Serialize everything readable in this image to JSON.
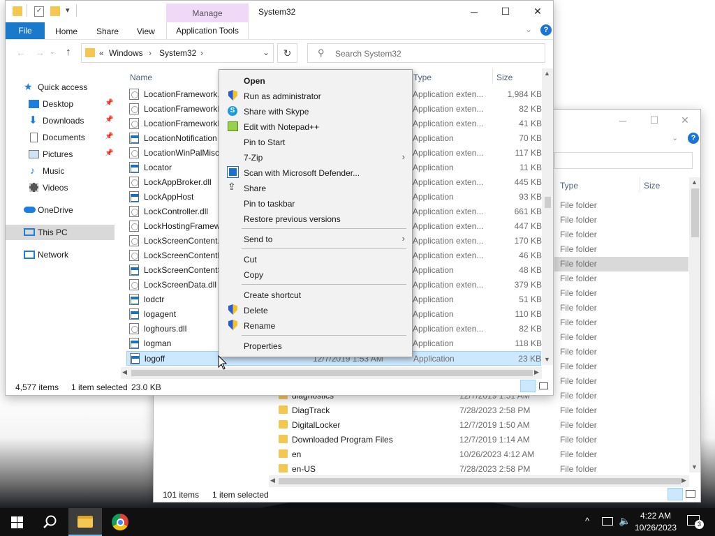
{
  "window_main": {
    "title": "System32",
    "context_tab_group": "Manage",
    "ribbon_tabs": [
      "File",
      "Home",
      "Share",
      "View",
      "Application Tools"
    ],
    "breadcrumb": {
      "overflow": "«",
      "parts": [
        "Windows",
        "System32"
      ]
    },
    "search_placeholder": "Search System32",
    "columns": {
      "name": "Name",
      "type": "Type",
      "size": "Size"
    },
    "nav": {
      "quick_access": "Quick access",
      "desktop": "Desktop",
      "downloads": "Downloads",
      "documents": "Documents",
      "pictures": "Pictures",
      "music": "Music",
      "videos": "Videos",
      "onedrive": "OneDrive",
      "this_pc": "This PC",
      "network": "Network"
    },
    "files": [
      {
        "name": "LocationFramework.",
        "type": "Application exten...",
        "size": "1,984 KB",
        "icon": "dll"
      },
      {
        "name": "LocationFrameworkI",
        "type": "Application exten...",
        "size": "82 KB",
        "icon": "dll"
      },
      {
        "name": "LocationFrameworkI",
        "type": "Application exten...",
        "size": "41 KB",
        "icon": "dll"
      },
      {
        "name": "LocationNotification",
        "type": "Application",
        "size": "70 KB",
        "icon": "app"
      },
      {
        "name": "LocationWinPalMisc",
        "type": "Application exten...",
        "size": "117 KB",
        "icon": "dll"
      },
      {
        "name": "Locator",
        "type": "Application",
        "size": "11 KB",
        "icon": "app"
      },
      {
        "name": "LockAppBroker.dll",
        "type": "Application exten...",
        "size": "445 KB",
        "icon": "dll"
      },
      {
        "name": "LockAppHost",
        "type": "Application",
        "size": "93 KB",
        "icon": "app"
      },
      {
        "name": "LockController.dll",
        "type": "Application exten...",
        "size": "661 KB",
        "icon": "dll"
      },
      {
        "name": "LockHostingFramew",
        "type": "Application exten...",
        "size": "447 KB",
        "icon": "dll"
      },
      {
        "name": "LockScreenContent.",
        "type": "Application exten...",
        "size": "170 KB",
        "icon": "dll"
      },
      {
        "name": "LockScreenContentH",
        "type": "Application exten...",
        "size": "46 KB",
        "icon": "dll"
      },
      {
        "name": "LockScreenContentS",
        "type": "Application",
        "size": "48 KB",
        "icon": "app"
      },
      {
        "name": "LockScreenData.dll",
        "type": "Application exten...",
        "size": "379 KB",
        "icon": "dll"
      },
      {
        "name": "lodctr",
        "type": "Application",
        "size": "51 KB",
        "icon": "app"
      },
      {
        "name": "logagent",
        "type": "Application",
        "size": "110 KB",
        "icon": "app"
      },
      {
        "name": "loghours.dll",
        "type": "Application exten...",
        "size": "82 KB",
        "icon": "dll"
      },
      {
        "name": "logman",
        "type": "Application",
        "size": "118 KB",
        "icon": "app"
      },
      {
        "name": "logoff",
        "date": "12/7/2019 1:53 AM",
        "type": "Application",
        "size": "23 KB",
        "icon": "app",
        "selected": true
      }
    ],
    "status": {
      "count": "4,577 items",
      "selected": "1 item selected",
      "size": "23.0 KB"
    }
  },
  "context_menu": [
    {
      "label": "Open",
      "bold": true
    },
    {
      "label": "Run as administrator",
      "icon": "shield-icon"
    },
    {
      "label": "Share with Skype",
      "icon": "skype-icon"
    },
    {
      "label": "Edit with Notepad++",
      "icon": "notepadpp-icon"
    },
    {
      "label": "Pin to Start"
    },
    {
      "label": "7-Zip",
      "submenu": true
    },
    {
      "label": "Scan with Microsoft Defender...",
      "icon": "defender-icon"
    },
    {
      "label": "Share",
      "icon": "share-icon"
    },
    {
      "label": "Pin to taskbar"
    },
    {
      "label": "Restore previous versions"
    },
    {
      "sep": true
    },
    {
      "label": "Send to",
      "submenu": true
    },
    {
      "sep": true
    },
    {
      "label": "Cut"
    },
    {
      "label": "Copy"
    },
    {
      "sep": true
    },
    {
      "label": "Create shortcut"
    },
    {
      "label": "Delete",
      "icon": "shield-icon"
    },
    {
      "label": "Rename",
      "icon": "shield-icon"
    },
    {
      "sep": true
    },
    {
      "label": "Properties"
    }
  ],
  "window_back": {
    "columns": {
      "type": "Type",
      "size": "Size"
    },
    "type_only_rows": [
      "File folder",
      "File folder",
      "File folder",
      "File folder",
      "File folder",
      "File folder",
      "File folder",
      "File folder",
      "File folder",
      "File folder",
      "File folder",
      "File folder",
      "File folder"
    ],
    "rows": [
      {
        "name": "diagnostics",
        "date": "12/7/2019 1:51 AM",
        "type": "File folder"
      },
      {
        "name": "DiagTrack",
        "date": "7/28/2023 2:58 PM",
        "type": "File folder"
      },
      {
        "name": "DigitalLocker",
        "date": "12/7/2019 1:50 AM",
        "type": "File folder"
      },
      {
        "name": "Downloaded Program Files",
        "date": "12/7/2019 1:14 AM",
        "type": "File folder"
      },
      {
        "name": "en",
        "date": "10/26/2023 4:12 AM",
        "type": "File folder"
      },
      {
        "name": "en-US",
        "date": "7/28/2023 2:58 PM",
        "type": "File folder"
      }
    ],
    "status": {
      "count": "101 items",
      "selected": "1 item selected"
    }
  },
  "taskbar": {
    "time": "4:22 AM",
    "date": "10/26/2023",
    "notification_count": "3"
  }
}
